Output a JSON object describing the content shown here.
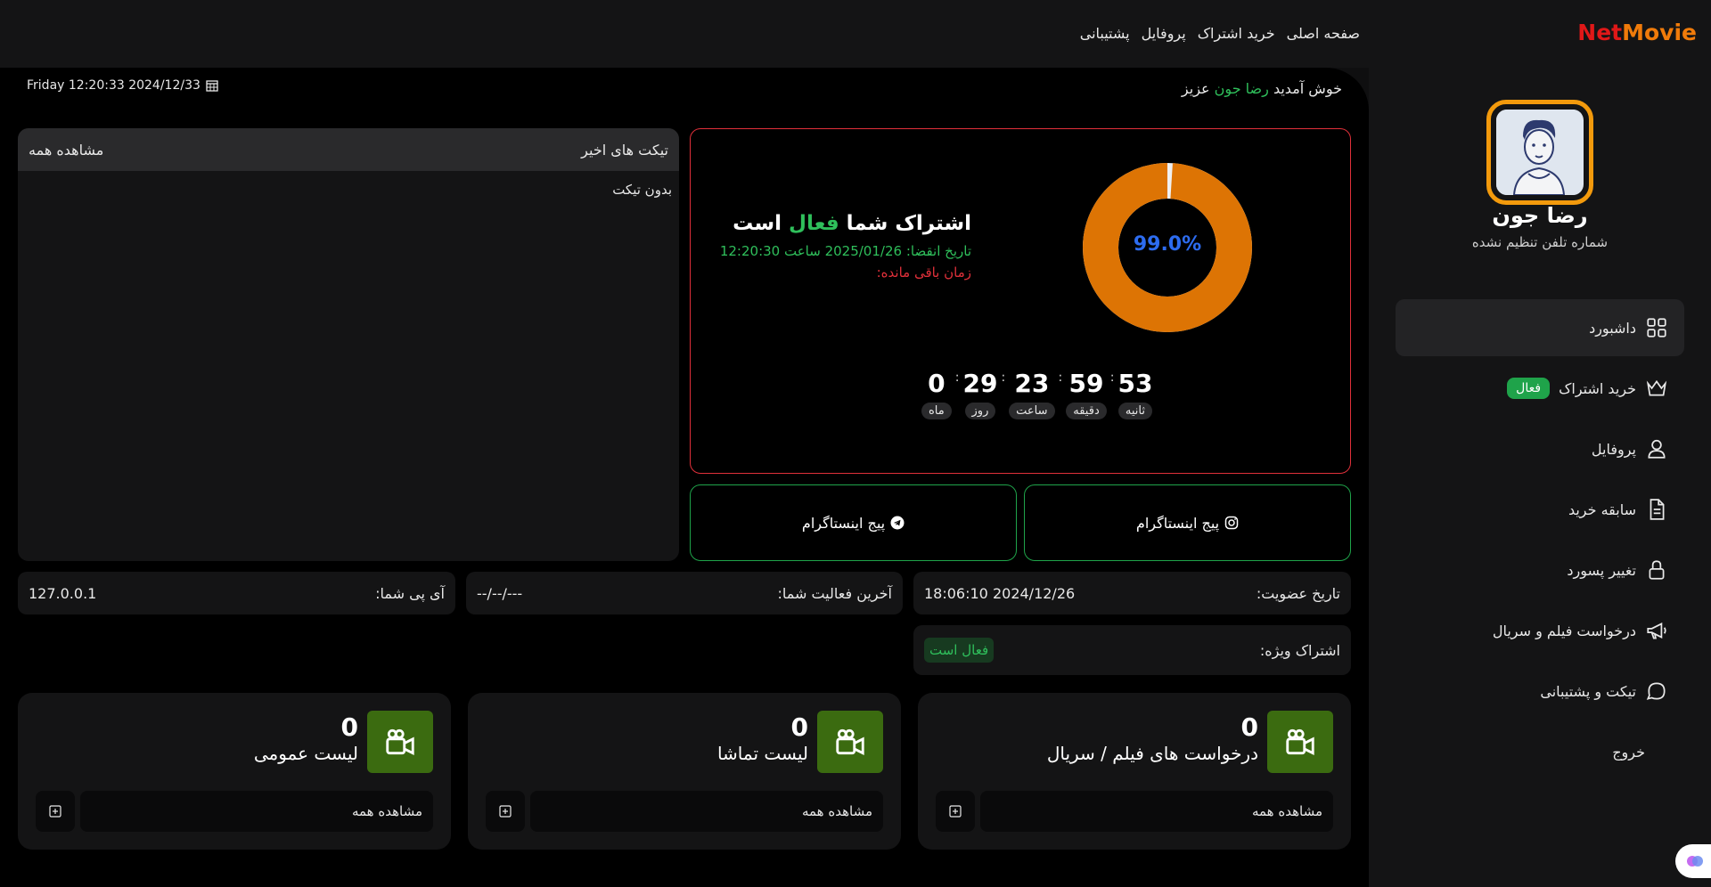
{
  "brand": {
    "net": "Net",
    "movie": "Movie"
  },
  "nav": [
    "صفحه اصلی",
    "خرید اشتراک",
    "پروفایل",
    "پشتیبانی"
  ],
  "header": {
    "welcome_prefix": "خوش آمدید",
    "user_name": "رضا جون",
    "welcome_suffix": "عزیز",
    "datetime": "Friday 12:20:33 2024/12/33"
  },
  "user": {
    "name": "رضا جون",
    "phone": "شماره تلفن تنظیم نشده"
  },
  "sidebar": {
    "items": [
      {
        "label": "داشبورد",
        "icon": "grid-icon"
      },
      {
        "label": "خرید اشتراک",
        "icon": "crown-icon",
        "badge": "فعال"
      },
      {
        "label": "پروفایل",
        "icon": "user-icon"
      },
      {
        "label": "سابقه خرید",
        "icon": "document-icon"
      },
      {
        "label": "تغییر پسورد",
        "icon": "lock-icon"
      },
      {
        "label": "درخواست فیلم و سریال",
        "icon": "megaphone-icon"
      },
      {
        "label": "تیکت و پشتیبانی",
        "icon": "chat-icon"
      },
      {
        "label": "خروج",
        "icon": ""
      }
    ]
  },
  "subscription": {
    "percent_label": "99.0%",
    "percent": 99.0,
    "title_before": "اشتراک شما",
    "title_status": "فعال",
    "title_after": "است",
    "expiry": "تاریخ انقضا: 2025/01/26 ساعت 12:20:30",
    "remaining": "زمان باقی مانده:",
    "countdown": {
      "seconds": "53",
      "minutes": "59",
      "hours": "23",
      "days": "29",
      "months": "0",
      "seconds_label": "ثانیه",
      "minutes_label": "دقیقه",
      "hours_label": "ساعت",
      "days_label": "روز",
      "months_label": "ماه"
    },
    "colors": {
      "ring": "#dd7404",
      "ring_track": "#f0f0f0",
      "border": "#e0303a"
    }
  },
  "social": {
    "instagram_label": "پیج اینستاگرام",
    "telegram_label": "پیج اینستاگرام"
  },
  "tickets": {
    "title": "تیکت های اخیر",
    "view_all": "مشاهده همه",
    "empty": "بدون تیکت"
  },
  "info": {
    "join_label": "تاریخ عضویت:",
    "join_value": "2024/12/26 18:06:10",
    "activity_label": "آخرین فعالیت شما:",
    "activity_value": "---/--/--",
    "ip_label": "آی پی شما:",
    "ip_value": "127.0.0.1",
    "vip_label": "اشتراک ویژه:",
    "vip_value": "فعال است"
  },
  "stats": [
    {
      "count": "0",
      "label": "درخواست های فیلم / سریال",
      "view": "مشاهده همه"
    },
    {
      "count": "0",
      "label": "لیست تماشا",
      "view": "مشاهده همه"
    },
    {
      "count": "0",
      "label": "لیست عمومی",
      "view": "مشاهده همه"
    }
  ]
}
